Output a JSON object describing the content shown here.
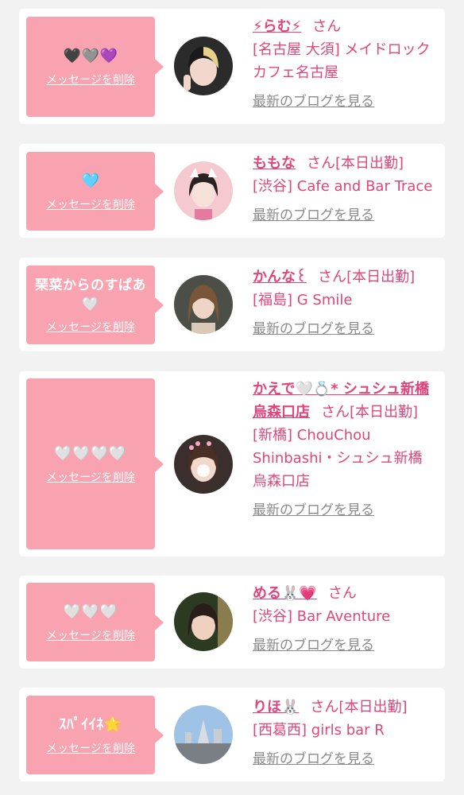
{
  "cards": [
    {
      "message": "🖤🩶💜",
      "delete_label": "メッセージを削除",
      "name": "⚡らむ⚡",
      "honorific": "さん",
      "status": "",
      "shop": "[名古屋 大須] メイドロックカフェ名古屋",
      "blog_label": "最新のブログを見る"
    },
    {
      "message": "🩵",
      "delete_label": "メッセージを削除",
      "name": "ももな",
      "honorific": "さん",
      "status": "[本日出勤]",
      "shop": "[渋谷] Cafe and Bar Trace",
      "blog_label": "最新のブログを見る"
    },
    {
      "message": "琹菜からのすぱあ🤍",
      "delete_label": "メッセージを削除",
      "name": "かんな꒰",
      "honorific": "さん",
      "status": "[本日出勤]",
      "shop": "[福島] G Smile",
      "blog_label": "最新のブログを見る"
    },
    {
      "message": "🤍🤍🤍🤍",
      "delete_label": "メッセージを削除",
      "name": "かえで🤍💍* シュシュ新橋烏森口店",
      "honorific": "さん",
      "status": "[本日出勤]",
      "shop": "[新橋] ChouChou Shinbashi・シュシュ新橋烏森口店",
      "blog_label": "最新のブログを見る"
    },
    {
      "message": "🤍🤍🤍",
      "delete_label": "メッセージを削除",
      "name": "める🐰💗",
      "honorific": "さん",
      "status": "",
      "shop": "[渋谷] Bar Aventure",
      "blog_label": "最新のブログを見る"
    },
    {
      "message": "ｽﾊﾟｲｲﾈ🌟",
      "delete_label": "メッセージを削除",
      "name": "りほ🐰",
      "honorific": "さん",
      "status": "[本日出勤]",
      "shop": "[西葛西] girls bar R",
      "blog_label": "最新のブログを見る"
    }
  ]
}
